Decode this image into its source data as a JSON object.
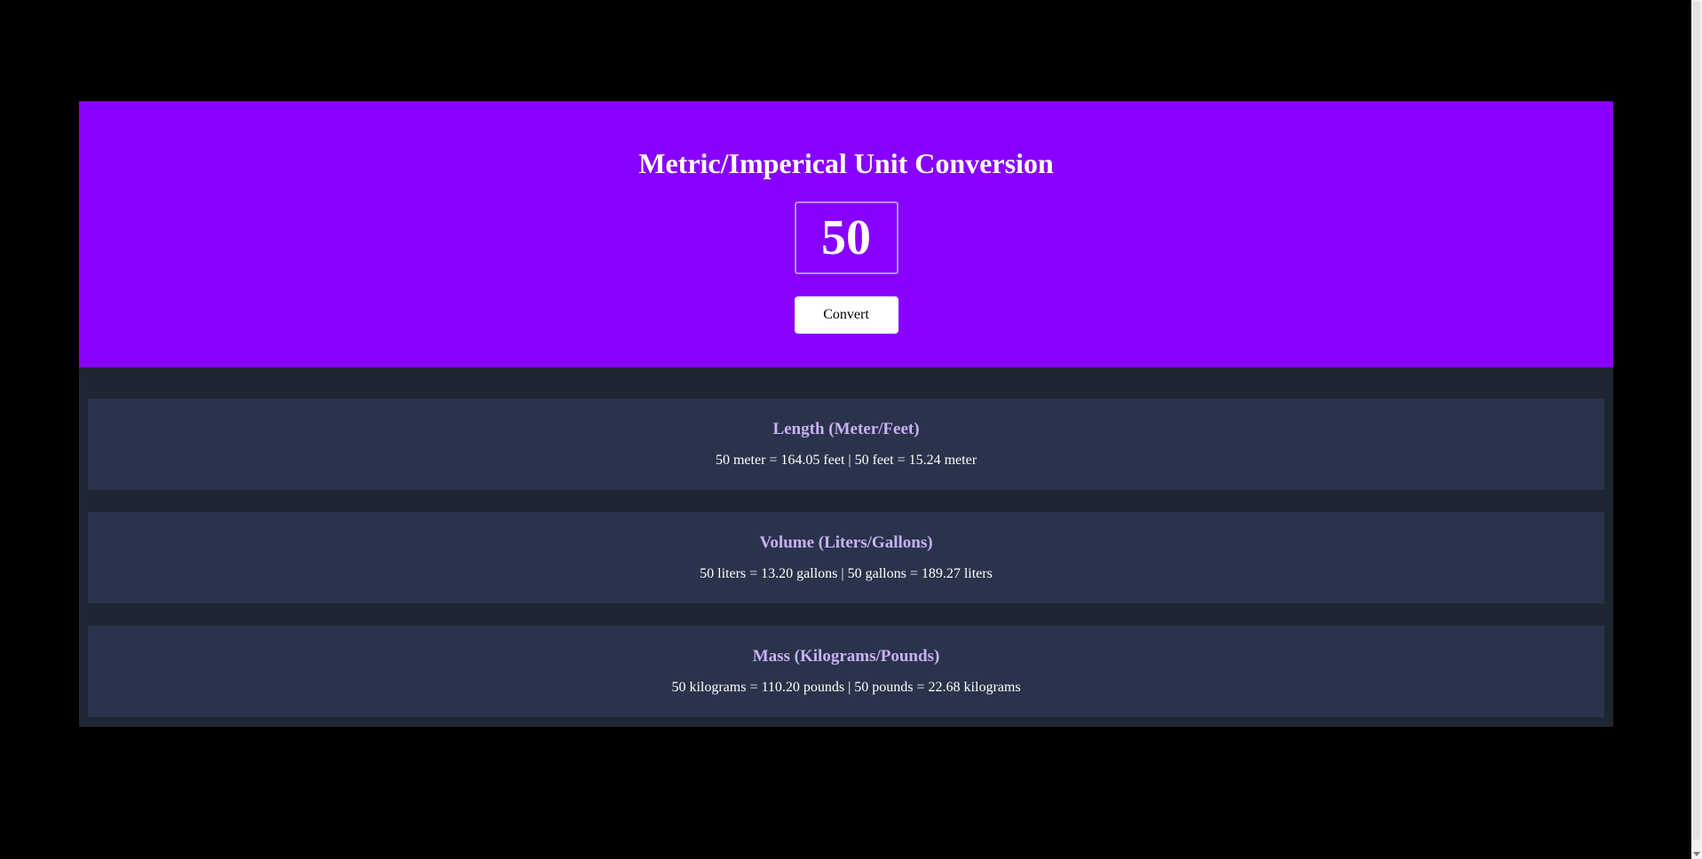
{
  "header": {
    "title": "Metric/Imperical Unit Conversion"
  },
  "input": {
    "value": "50"
  },
  "convert_button": {
    "label": "Convert"
  },
  "cards": [
    {
      "title": "Length (Meter/Feet)",
      "text": "50 meter = 164.05 feet | 50 feet = 15.24 meter"
    },
    {
      "title": "Volume (Liters/Gallons)",
      "text": "50 liters = 13.20 gallons | 50 gallons = 189.27 liters"
    },
    {
      "title": "Mass (Kilograms/Pounds)",
      "text": "50 kilograms = 110.20 pounds | 50 pounds = 22.68 kilograms"
    }
  ],
  "colors": {
    "page_background": "#000000",
    "hero_background": "#8800ff",
    "results_background": "#1f2633",
    "card_background": "#2a334b",
    "card_title": "#c8b2f5",
    "text": "#ffffff"
  }
}
